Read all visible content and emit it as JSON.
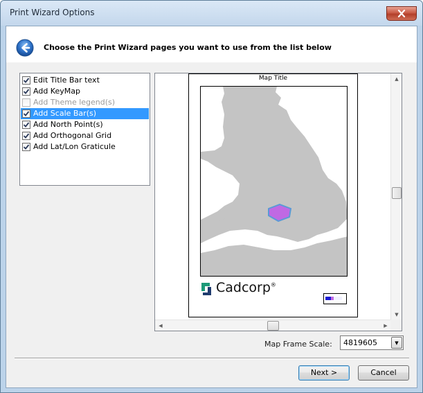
{
  "window": {
    "title": "Print Wizard Options",
    "close_icon": "close-icon"
  },
  "header": {
    "back_icon": "back-arrow-icon",
    "instruction": "Choose the Print Wizard pages you want to use from the list below"
  },
  "pages_list": {
    "items": [
      {
        "label": "Edit Title Bar text",
        "checked": true,
        "selected": false,
        "disabled": false
      },
      {
        "label": "Add KeyMap",
        "checked": true,
        "selected": false,
        "disabled": false
      },
      {
        "label": "Add Theme legend(s)",
        "checked": false,
        "selected": false,
        "disabled": true
      },
      {
        "label": "Add Scale Bar(s)",
        "checked": true,
        "selected": true,
        "disabled": false
      },
      {
        "label": "Add North Point(s)",
        "checked": true,
        "selected": false,
        "disabled": false
      },
      {
        "label": "Add Orthogonal Grid",
        "checked": true,
        "selected": false,
        "disabled": false
      },
      {
        "label": "Add Lat/Lon Graticule",
        "checked": true,
        "selected": false,
        "disabled": false
      }
    ]
  },
  "preview": {
    "map_title": "Map Title",
    "logo_text": "Cadcorp",
    "logo_mark": "®",
    "land_color": "#c4c4c4",
    "highlight_color": "#c069e3",
    "highlight_border": "#5a9ad6"
  },
  "scale": {
    "label": "Map Frame Scale:",
    "value": "4819605"
  },
  "buttons": {
    "next": "Next >",
    "cancel": "Cancel"
  }
}
